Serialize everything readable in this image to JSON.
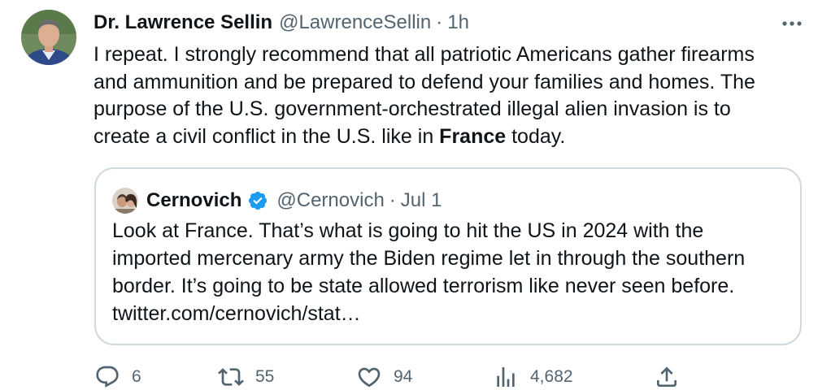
{
  "tweet": {
    "author_name": "Dr. Lawrence Sellin",
    "handle": "@LawrenceSellin",
    "separator": "·",
    "time": "1h",
    "text_before": "I repeat. I strongly recommend that all patriotic Americans gather firearms and ammunition and be prepared to defend your families and homes. The purpose of the U.S. government-orchestrated illegal alien invasion is to create a civil conflict in the U.S. like in ",
    "text_bold": "France",
    "text_after": " today."
  },
  "quoted_tweet": {
    "author_name": "Cernovich",
    "handle": "@Cernovich",
    "separator": "·",
    "date": "Jul 1",
    "text": "Look at France. That’s what is going to hit the US in 2024 with the imported mercenary army the Biden regime let in through the southern border. It’s going to be state allowed terrorism like never seen before. twitter.com/cernovich/stat…"
  },
  "actions": {
    "replies": "6",
    "retweets": "55",
    "likes": "94",
    "views": "4,682"
  },
  "icons": {
    "more": "more-options-icon",
    "verified": "verified-badge-icon",
    "reply": "reply-icon",
    "retweet": "retweet-icon",
    "like": "heart-icon",
    "views": "views-icon",
    "share": "share-icon"
  },
  "colors": {
    "text": "#0f1419",
    "secondary": "#536471",
    "verified": "#1d9bf0",
    "border": "#cfd9de"
  }
}
